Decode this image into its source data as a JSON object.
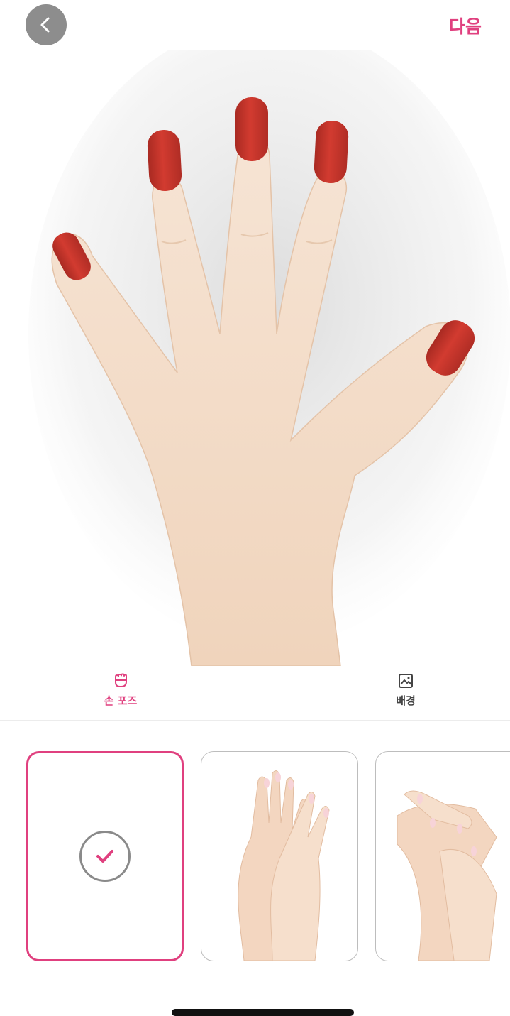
{
  "header": {
    "back_icon": "chevron-left-icon",
    "next_label": "다음"
  },
  "preview": {
    "nail_color": "#c8342b",
    "skin_color": "#f3d9c2"
  },
  "tabs": [
    {
      "label": "손 포즈",
      "icon": "hand-icon",
      "active": true
    },
    {
      "label": "배경",
      "icon": "image-icon",
      "active": false
    }
  ],
  "thumbnails": [
    {
      "kind": "none",
      "selected": true,
      "icon": "check-circle-icon"
    },
    {
      "kind": "pose-hands-overlap",
      "selected": false
    },
    {
      "kind": "pose-hands-crossed",
      "selected": false
    }
  ],
  "colors": {
    "accent": "#e0407f",
    "back_button_bg": "#8d8d8d",
    "thumb_border": "#bdbdbd"
  }
}
